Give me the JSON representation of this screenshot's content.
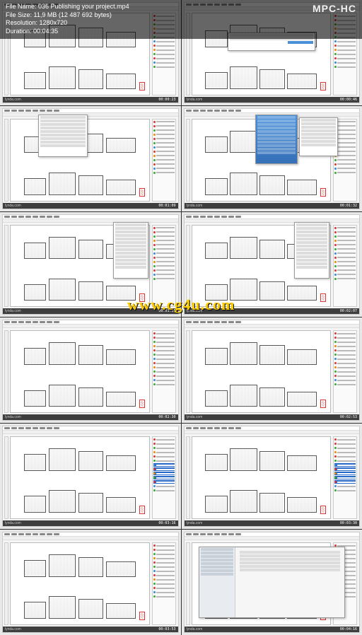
{
  "header": {
    "file_name_label": "File Name:",
    "file_name": "036 Publishing your project.mp4",
    "file_size_label": "File Size:",
    "file_size": "11,9 MB (12 487 692 bytes)",
    "resolution_label": "Resolution:",
    "resolution": "1280x720",
    "duration_label": "Duration:",
    "duration": "00:04:35",
    "player": "MPC-HC"
  },
  "watermark": "www.cg4u.com",
  "lynda": "lynda.com",
  "thumbs": [
    {
      "ts": "00:00:23",
      "popup": null
    },
    {
      "ts": "00:00:46",
      "popup": "dialog"
    },
    {
      "ts": "00:01:09",
      "popup": "menu-list"
    },
    {
      "ts": "00:01:32",
      "popup": "menu-blue"
    },
    {
      "ts": "00:01:55",
      "popup": "panel-tree"
    },
    {
      "ts": "00:02:07",
      "popup": "panel-tree"
    },
    {
      "ts": "00:02:30",
      "popup": null
    },
    {
      "ts": "00:02:53",
      "popup": null
    },
    {
      "ts": "00:03:16",
      "popup": null,
      "selected": true
    },
    {
      "ts": "00:03:30",
      "popup": null,
      "selected": true
    },
    {
      "ts": "00:03:53",
      "popup": null
    },
    {
      "ts": "00:04:16",
      "popup": "finder"
    }
  ]
}
